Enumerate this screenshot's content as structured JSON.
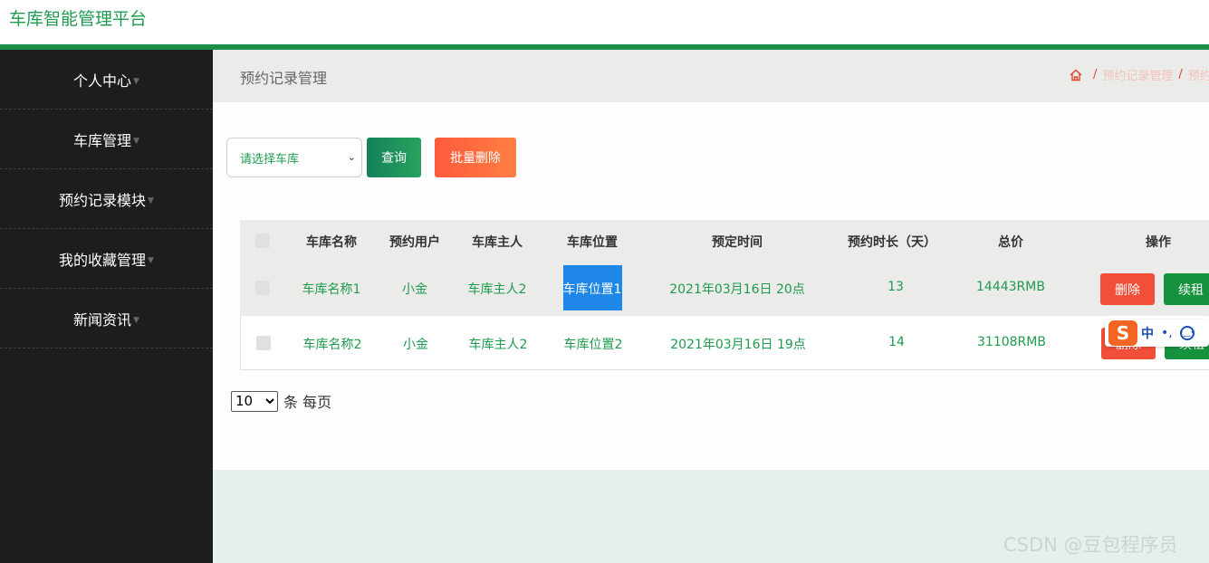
{
  "app": {
    "title": "车库智能管理平台"
  },
  "sidebar": {
    "items": [
      {
        "label": "个人中心"
      },
      {
        "label": "车库管理"
      },
      {
        "label": "预约记录模块"
      },
      {
        "label": "我的收藏管理"
      },
      {
        "label": "新闻资讯"
      }
    ]
  },
  "header": {
    "page_title": "预约记录管理",
    "breadcrumb": [
      "预约记录管理",
      "预约"
    ]
  },
  "toolbar": {
    "select_placeholder": "请选择车库",
    "query_label": "查询",
    "batch_delete_label": "批量删除"
  },
  "table": {
    "columns": [
      "车库名称",
      "预约用户",
      "车库主人",
      "车库位置",
      "预定时间",
      "预约时长（天）",
      "总价",
      "操作"
    ],
    "rows": [
      {
        "name": "车库名称1",
        "user": "小金",
        "owner": "车库主人2",
        "location": "车库位置1",
        "time": "2021年03月16日 20点",
        "days": "13",
        "price": "14443RMB"
      },
      {
        "name": "车库名称2",
        "user": "小金",
        "owner": "车库主人2",
        "location": "车库位置2",
        "time": "2021年03月16日 19点",
        "days": "14",
        "price": "31108RMB"
      }
    ],
    "delete_label": "删除",
    "renew_label": "续租"
  },
  "pager": {
    "page_size": "10",
    "suffix": "条 每页"
  },
  "ime": {
    "mode": "中",
    "punct": "•,"
  },
  "watermark": "CSDN @豆包程序员",
  "colors": {
    "brand_green": "#1e9b4f",
    "sidebar_bg": "#1c1d1d",
    "danger": "#f24e38"
  }
}
